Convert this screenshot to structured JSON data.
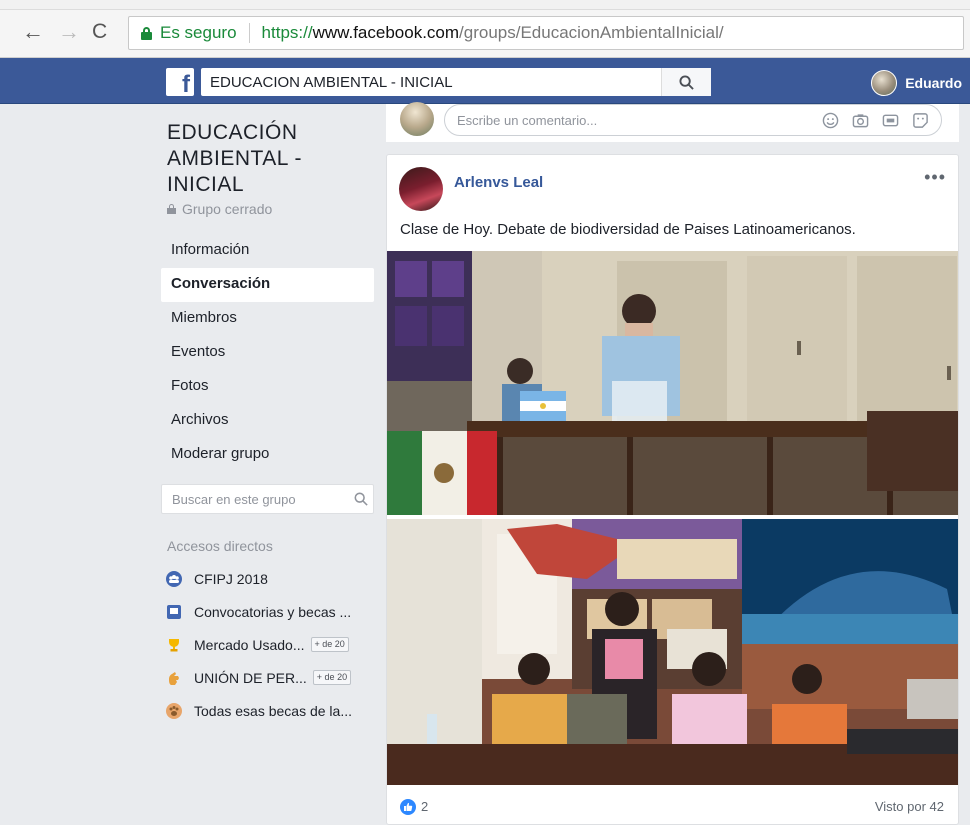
{
  "browser": {
    "secure_label": "Es seguro",
    "url_scheme": "https://",
    "url_host": "www.facebook.com",
    "url_path": "/groups/EducacionAmbientalInicial/"
  },
  "topbar": {
    "search_value": "EDUCACION AMBIENTAL - INICIAL",
    "user_name": "Eduardo"
  },
  "group": {
    "title": "EDUCACIÓN AMBIENTAL - INICIAL",
    "type": "Grupo cerrado",
    "nav": [
      {
        "label": "Información",
        "active": false
      },
      {
        "label": "Conversación",
        "active": true
      },
      {
        "label": "Miembros",
        "active": false
      },
      {
        "label": "Eventos",
        "active": false
      },
      {
        "label": "Fotos",
        "active": false
      },
      {
        "label": "Archivos",
        "active": false
      },
      {
        "label": "Moderar grupo",
        "active": false
      }
    ],
    "search_placeholder": "Buscar en este grupo"
  },
  "shortcuts": {
    "title": "Accesos directos",
    "items": [
      {
        "label": "CFIPJ 2018",
        "badge": "",
        "icon": "group-icon"
      },
      {
        "label": "Convocatorias y becas ...",
        "badge": "",
        "icon": "page-icon"
      },
      {
        "label": "Mercado Usado...",
        "badge": "+ de 20",
        "icon": "trophy-icon"
      },
      {
        "label": "UNIÓN DE PER...",
        "badge": "+ de 20",
        "icon": "hand-icon"
      },
      {
        "label": "Todas esas becas de la...",
        "badge": "",
        "icon": "paw-icon"
      }
    ]
  },
  "composer": {
    "placeholder": "Escribe un comentario..."
  },
  "post": {
    "author": "Arlenvs Leal",
    "more": "•••",
    "text": "Clase de Hoy. Debate de biodiversidad de Paises Latinoamericanos.",
    "likes": "2",
    "seen_by": "Visto por 42"
  }
}
